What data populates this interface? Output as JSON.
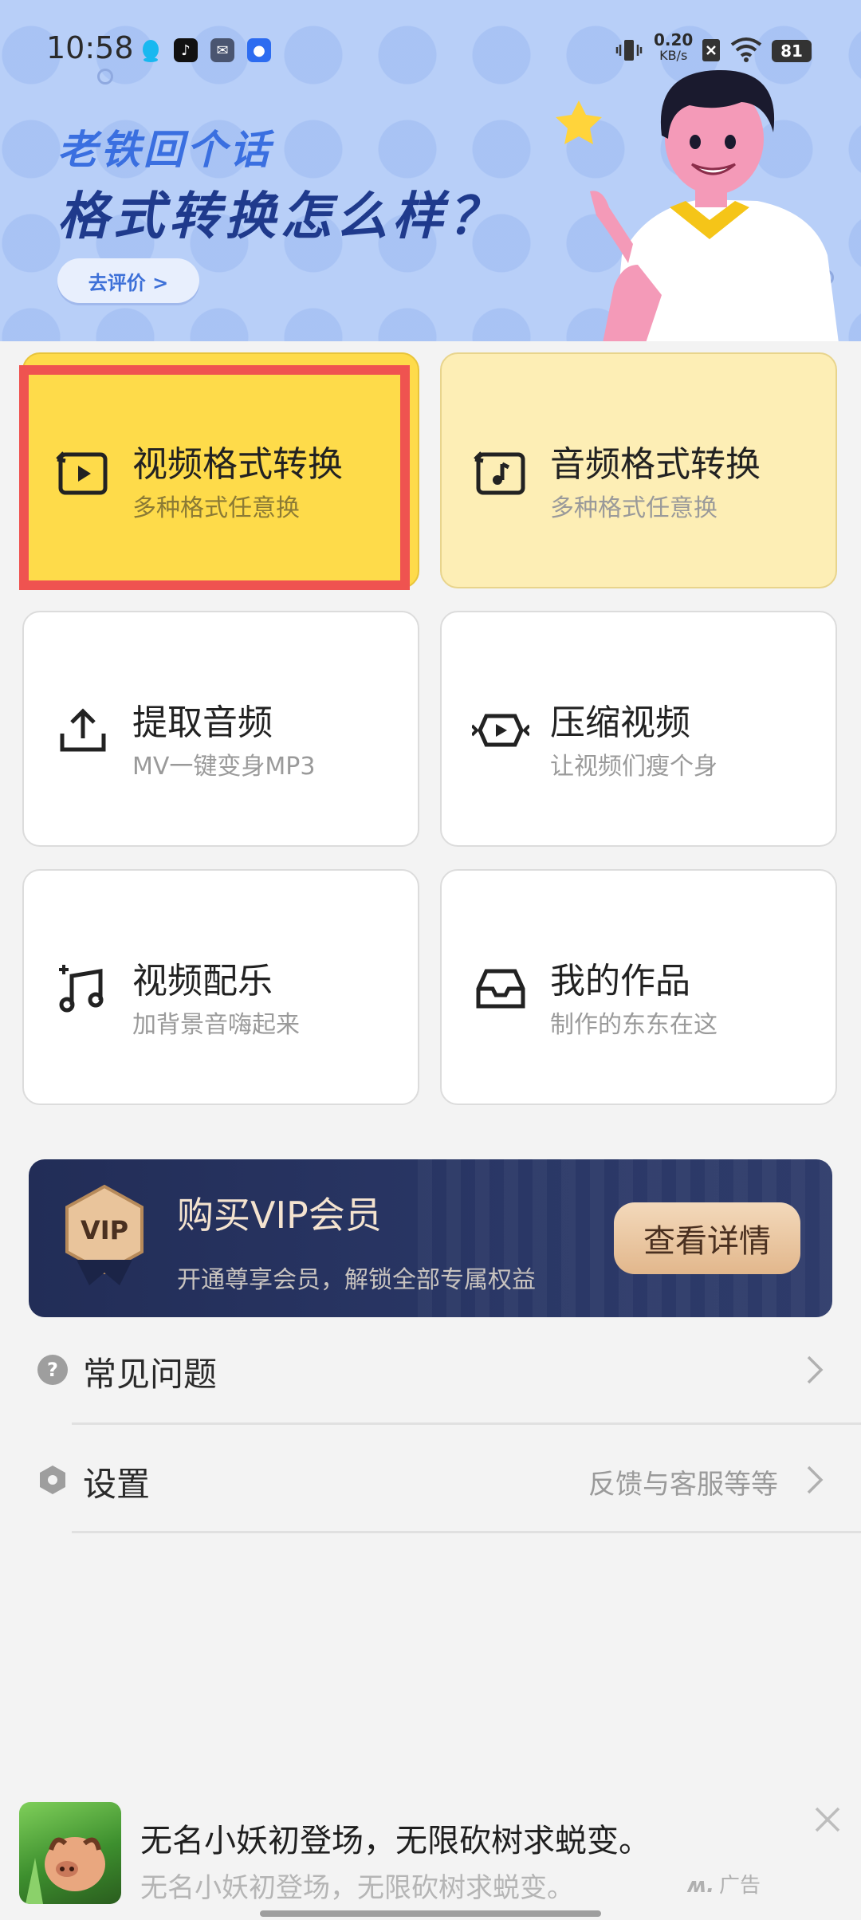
{
  "status_bar": {
    "time": "10:58",
    "net_speed_value": "0.20",
    "net_speed_unit": "KB/s",
    "battery": "81"
  },
  "banner": {
    "line1": "老铁回个话",
    "line2": "格式转换怎么样？",
    "button_label": "去评价 >"
  },
  "tools": [
    {
      "title": "视频格式转换",
      "subtitle": "多种格式任意换",
      "icon": "video-convert-icon",
      "style": "selected"
    },
    {
      "title": "音频格式转换",
      "subtitle": "多种格式任意换",
      "icon": "audio-convert-icon",
      "style": "yellow"
    },
    {
      "title": "提取音频",
      "subtitle": "MV一键变身MP3",
      "icon": "upload-icon",
      "style": "white"
    },
    {
      "title": "压缩视频",
      "subtitle": "让视频们瘦个身",
      "icon": "compress-video-icon",
      "style": "white"
    },
    {
      "title": "视频配乐",
      "subtitle": "加背景音嗨起来",
      "icon": "music-note-icon",
      "style": "white"
    },
    {
      "title": "我的作品",
      "subtitle": "制作的东东在这",
      "icon": "inbox-icon",
      "style": "white"
    }
  ],
  "vip": {
    "badge": "VIP",
    "title": "购买VIP会员",
    "subtitle": "开通尊享会员，解锁全部专属权益",
    "button_label": "查看详情",
    "accent": "#e2b78c"
  },
  "menu": [
    {
      "label": "常见问题",
      "hint": "",
      "icon": "help-icon"
    },
    {
      "label": "设置",
      "hint": "反馈与客服等等",
      "icon": "settings-icon"
    }
  ],
  "ad": {
    "title": "无名小妖初登场，无限砍树求蜕变。",
    "subtitle": "无名小妖初登场，无限砍树求蜕变。",
    "tag": "广告"
  },
  "colors": {
    "selected_card": "#fedb4a",
    "highlight": "#ef5350",
    "banner_bg": "#b8cff8"
  }
}
